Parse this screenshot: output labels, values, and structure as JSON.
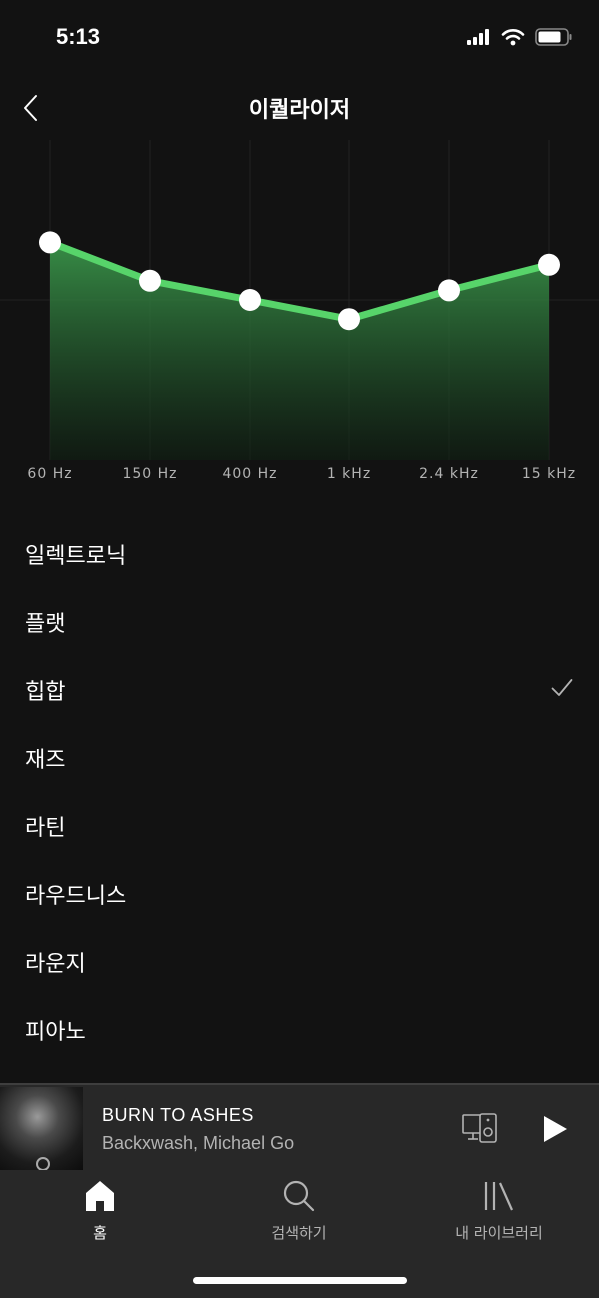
{
  "status_bar": {
    "time": "5:13"
  },
  "header": {
    "title": "이퀄라이저"
  },
  "equalizer": {
    "bands": [
      {
        "label": "60 Hz",
        "level": 0.68
      },
      {
        "label": "150 Hz",
        "level": 0.56
      },
      {
        "label": "400 Hz",
        "level": 0.5
      },
      {
        "label": "1 kHz",
        "level": 0.44
      },
      {
        "label": "2.4 kHz",
        "level": 0.53
      },
      {
        "label": "15 kHz",
        "level": 0.61
      }
    ],
    "accent_color": "#57d46a"
  },
  "presets": {
    "items": [
      {
        "label": "일렉트로닉",
        "selected": false
      },
      {
        "label": "플랫",
        "selected": false
      },
      {
        "label": "힙합",
        "selected": true
      },
      {
        "label": "재즈",
        "selected": false
      },
      {
        "label": "라틴",
        "selected": false
      },
      {
        "label": "라우드니스",
        "selected": false
      },
      {
        "label": "라운지",
        "selected": false
      },
      {
        "label": "피아노",
        "selected": false
      }
    ]
  },
  "now_playing": {
    "title": "BURN TO ASHES",
    "artist": "Backxwash, Michael Go"
  },
  "tabs": [
    {
      "label": "홈",
      "icon": "home-icon",
      "active": true
    },
    {
      "label": "검색하기",
      "icon": "search-icon",
      "active": false
    },
    {
      "label": "내 라이브러리",
      "icon": "library-icon",
      "active": false
    }
  ]
}
